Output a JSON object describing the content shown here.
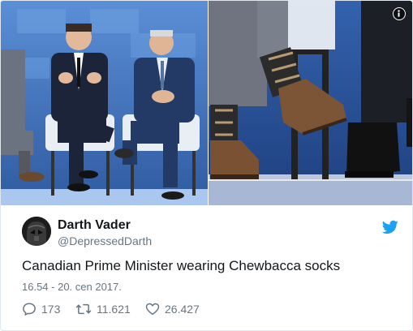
{
  "media": {
    "left_photo_label": "",
    "right_photo_label": ""
  },
  "author": {
    "display_name": "Darth Vader",
    "handle": "@DepressedDarth"
  },
  "tweet": {
    "text": "Canadian Prime Minister wearing Chewbacca socks",
    "timestamp": "16.54 - 20. cen 2017."
  },
  "actions": {
    "replies": "173",
    "retweets": "11.621",
    "likes": "26.427"
  },
  "icons": {
    "info": "info-icon",
    "bird": "twitter-bird-icon",
    "reply": "reply-icon",
    "retweet": "retweet-icon",
    "like": "heart-icon"
  },
  "colors": {
    "brand": "#1da1f2",
    "muted": "#657786",
    "text": "#14171a",
    "border": "#e1e8ed"
  }
}
